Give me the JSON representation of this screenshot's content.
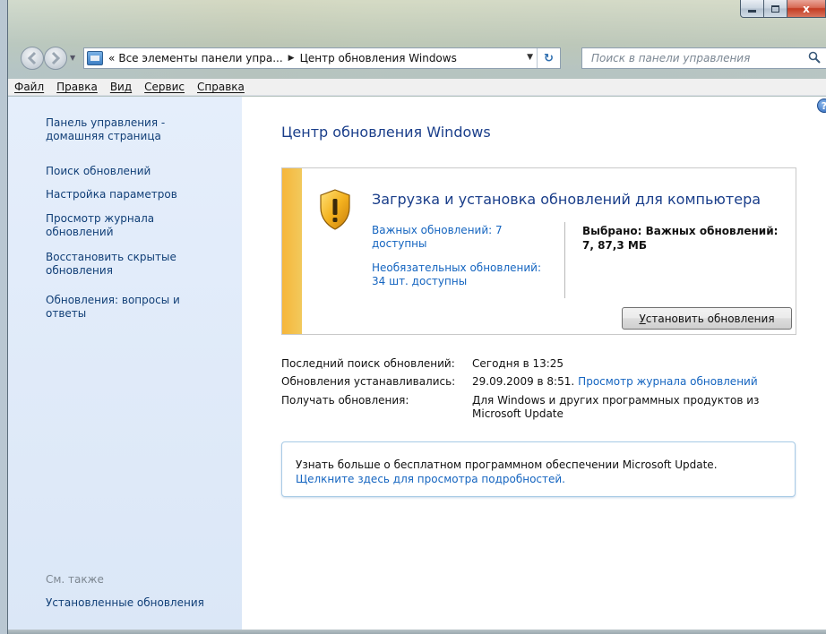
{
  "window": {
    "caption_close": "x"
  },
  "address": {
    "crumb_prefix": "«",
    "crumb_1": "Все элементы панели упра...",
    "crumb_2": "Центр обновления Windows"
  },
  "search": {
    "placeholder": "Поиск в панели управления"
  },
  "menu": {
    "items": [
      "Файл",
      "Правка",
      "Вид",
      "Сервис",
      "Справка"
    ]
  },
  "sidebar": {
    "home_link": "Панель управления - домашняя страница",
    "links": [
      "Поиск обновлений",
      "Настройка параметров",
      "Просмотр журнала обновлений",
      "Восстановить скрытые обновления",
      "Обновления: вопросы и ответы"
    ],
    "see_also_label": "См. также",
    "installed_updates": "Установленные обновления"
  },
  "main": {
    "help_glyph": "?",
    "title": "Центр обновления Windows",
    "panel": {
      "title": "Загрузка и установка обновлений для компьютера",
      "important_link": "Важных обновлений: 7 доступны",
      "optional_link": "Необязательных обновлений: 34 шт. доступны",
      "selected_text": "Выбрано: Важных обновлений: 7, 87,3 МБ",
      "install_button_u": "У",
      "install_button_rest": "становить обновления"
    },
    "info": {
      "last_check_label": "Последний поиск обновлений:",
      "last_check_value": "Сегодня в 13:25",
      "installed_label": "Обновления устанавливались:",
      "installed_value": "29.09.2009 в 8:51.",
      "history_link": "Просмотр журнала обновлений",
      "receive_label": "Получать обновления:",
      "receive_value": "Для Windows и других программных продуктов из Microsoft Update"
    },
    "promo": {
      "text": "Узнать больше о бесплатном программном обеспечении Microsoft Update.",
      "link": "Щелкните здесь для просмотра подробностей."
    }
  },
  "colors": {
    "link": "#1565c0",
    "title": "#1a3e8a",
    "sidebar_bg": "#dbe7f7",
    "warning_stripe": "#f6b63a"
  }
}
